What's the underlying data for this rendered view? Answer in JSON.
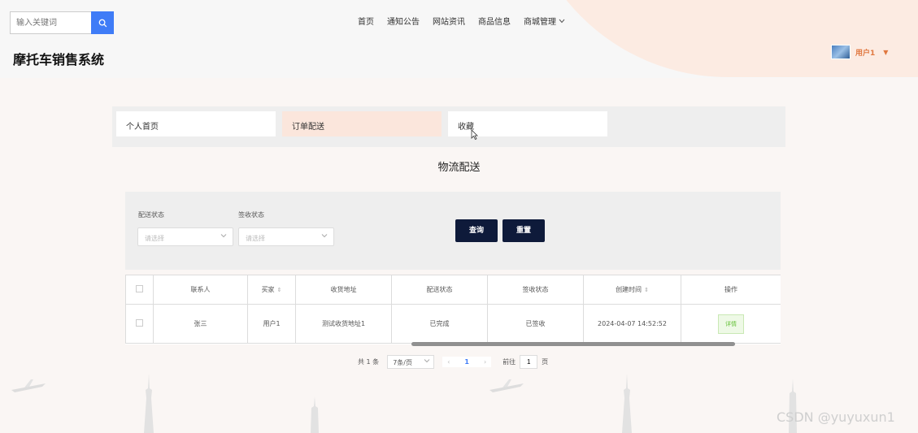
{
  "search": {
    "placeholder": "输入关键词"
  },
  "nav": [
    {
      "label": "首页"
    },
    {
      "label": "通知公告"
    },
    {
      "label": "网站资讯"
    },
    {
      "label": "商品信息"
    },
    {
      "label": "商城管理"
    }
  ],
  "site_title": "摩托车销售系统",
  "user": {
    "name": "用户1"
  },
  "tabs": [
    {
      "label": "个人首页"
    },
    {
      "label": "订单配送"
    },
    {
      "label": "收藏"
    }
  ],
  "section_title": "物流配送",
  "filters": {
    "delivery_status_label": "配送状态",
    "delivery_status_placeholder": "请选择",
    "sign_status_label": "签收状态",
    "sign_status_placeholder": "请选择",
    "query_label": "查询",
    "reset_label": "重置"
  },
  "table": {
    "headers": [
      "联系人",
      "买家",
      "收货地址",
      "配送状态",
      "签收状态",
      "创建时间",
      "操作"
    ],
    "rows": [
      {
        "contact": "张三",
        "buyer": "用户1",
        "address": "测试收货地址1",
        "delivery_status": "已完成",
        "sign_status": "已签收",
        "created": "2024-04-07 14:52:52",
        "action": "详情"
      }
    ]
  },
  "pagination": {
    "total": "共 1 条",
    "page_size": "7条/页",
    "current": "1",
    "goto_label": "前往",
    "goto_value": "1",
    "page_unit": "页"
  },
  "watermark": "CSDN @yuyuxun1",
  "colors": {
    "accent": "#3f7cf7",
    "button_dark": "#0e1a3a",
    "user": "#e07840",
    "active_tab": "#fbe6dc"
  }
}
